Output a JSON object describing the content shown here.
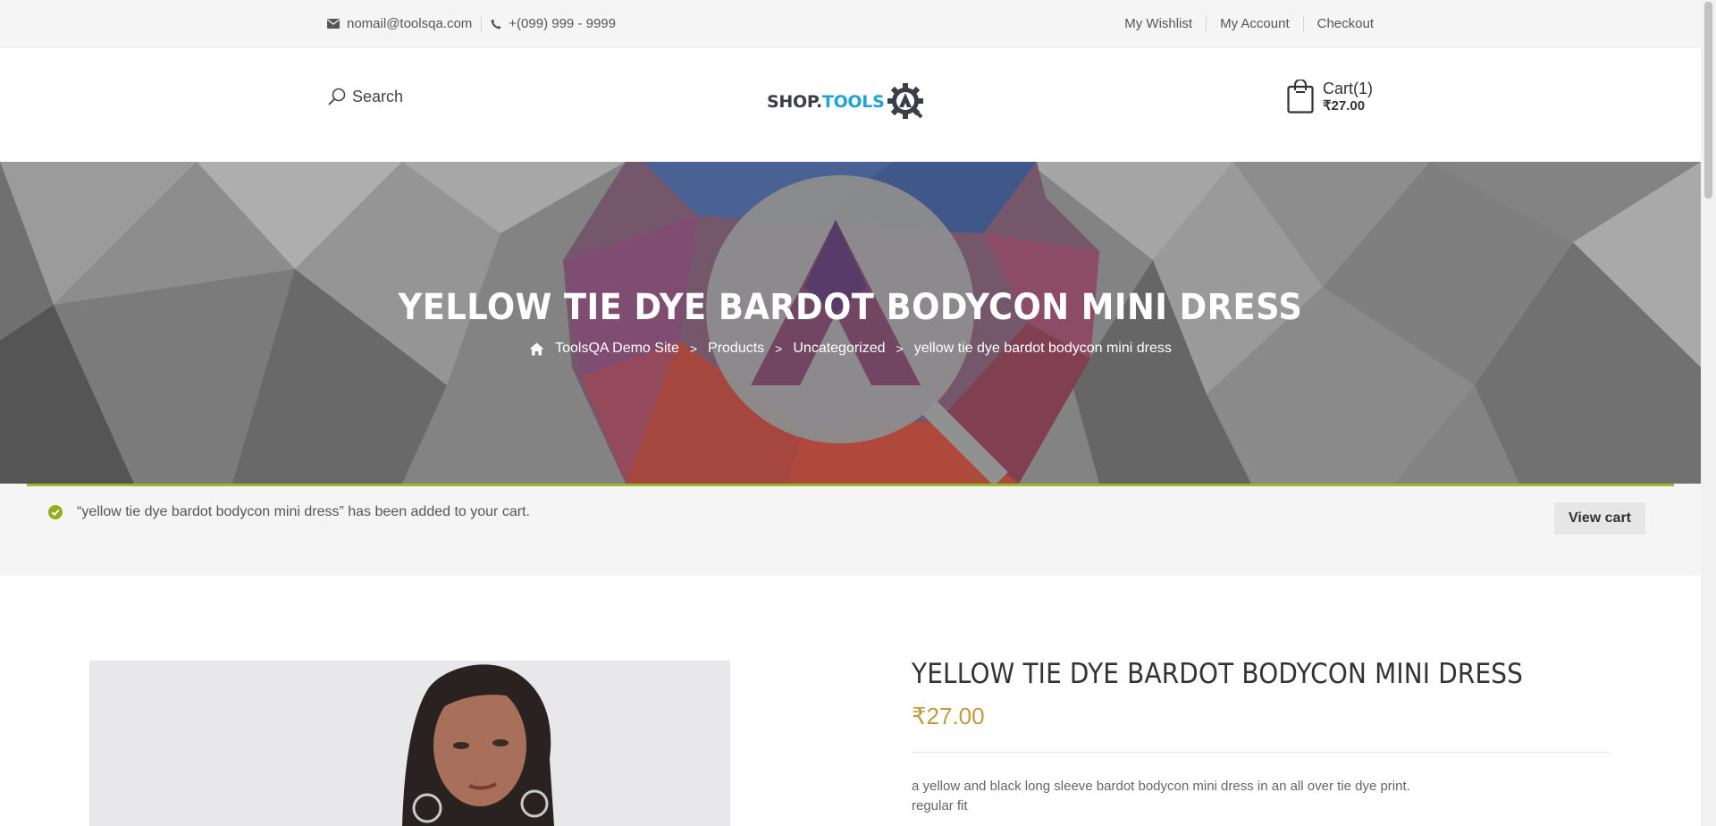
{
  "topbar": {
    "email": "nomail@toolsqa.com",
    "phone": "+(099) 999 - 9999",
    "links": [
      "My Wishlist",
      "My Account",
      "Checkout"
    ]
  },
  "header": {
    "search_label": "Search",
    "logo_text_1": "SHOP.",
    "logo_text_2": "TOOLS",
    "cart_label": "Cart(1)",
    "cart_total": "₹27.00"
  },
  "hero": {
    "title": "YELLOW TIE DYE BARDOT BODYCON MINI DRESS",
    "breadcrumbs": [
      "ToolsQA Demo Site",
      "Products",
      "Uncategorized",
      "yellow tie dye bardot bodycon mini dress"
    ],
    "separator": ">"
  },
  "notice": {
    "message": "“yellow tie dye bardot bodycon mini dress” has been added to your cart.",
    "button": "View cart"
  },
  "product": {
    "title": "YELLOW TIE DYE BARDOT BODYCON MINI DRESS",
    "price": "₹27.00",
    "description_line_1": "a yellow and black long sleeve bardot bodycon mini dress in an all over tie dye print.",
    "description_line_2": "regular fit"
  },
  "colors": {
    "accent_green": "#96ba2b",
    "price_gold": "#c19b3c",
    "logo_blue": "#23a1d8"
  }
}
